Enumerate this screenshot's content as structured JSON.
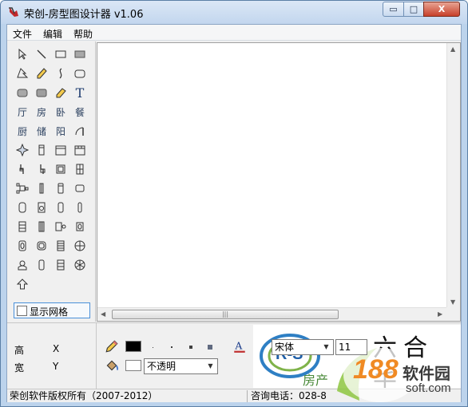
{
  "window": {
    "title": "荣创-房型图设计器 v1.06",
    "close_label": "X",
    "minimize_label": "▭",
    "maximize_label": "□"
  },
  "menu": {
    "file": "文件",
    "edit": "编辑",
    "help": "帮助"
  },
  "tools": {
    "living_room": "厅",
    "room": "房",
    "bedroom": "卧",
    "dining": "餐",
    "kitchen": "厨",
    "storage": "储",
    "balcony": "阳",
    "text": "T"
  },
  "show_grid_label": "显示网格",
  "coords": {
    "height_label": "高",
    "width_label": "宽",
    "x_label": "X",
    "y_label": "Y"
  },
  "style": {
    "line_color": "#000000",
    "fill_color": "#ffffff",
    "text_color": "#000080",
    "opacity_value": "不透明",
    "font_name": "宋体",
    "font_size": "11"
  },
  "banner": {
    "logo_text": "R-S",
    "brand_text": "房产",
    "slogan_text": "六合千"
  },
  "status": {
    "copyright": "荣创软件版权所有（2007-2012）",
    "phone": "咨询电话：028-8"
  },
  "watermark": {
    "number": "188",
    "name": "软件园",
    "domain": "soft.com"
  }
}
